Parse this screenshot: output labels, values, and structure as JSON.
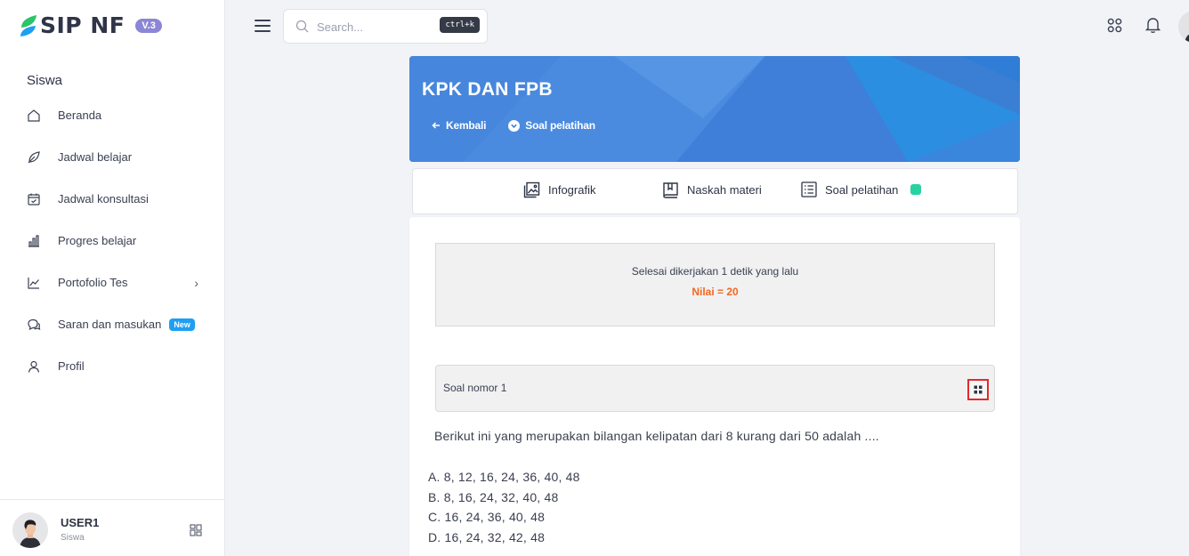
{
  "app": {
    "logo_text": "SIP NF",
    "version": "V.3"
  },
  "sidebar": {
    "section_title": "Siswa",
    "items": [
      {
        "label": "Beranda",
        "icon": "home-icon"
      },
      {
        "label": "Jadwal belajar",
        "icon": "leaf-icon"
      },
      {
        "label": "Jadwal konsultasi",
        "icon": "calendar-check-icon"
      },
      {
        "label": "Progres belajar",
        "icon": "bar-chart-icon"
      },
      {
        "label": "Portofolio Tes",
        "icon": "line-chart-icon"
      },
      {
        "label": "Saran dan masukan",
        "icon": "chat-icon",
        "badge": "New"
      },
      {
        "label": "Profil",
        "icon": "user-icon"
      }
    ]
  },
  "user": {
    "name": "USER1",
    "role": "Siswa"
  },
  "search": {
    "placeholder": "Search...",
    "shortcut": "ctrl+k"
  },
  "banner": {
    "title": "KPK DAN FPB",
    "back_label": "Kembali",
    "dropdown_label": "Soal pelatihan"
  },
  "tabs": [
    {
      "label": "Infografik",
      "icon": "image-icon"
    },
    {
      "label": "Naskah materi",
      "icon": "book-icon"
    },
    {
      "label": "Soal pelatihan",
      "icon": "list-icon"
    }
  ],
  "result": {
    "status": "Selesai dikerjakan 1 detik yang lalu",
    "score": "Nilai = 20"
  },
  "question": {
    "number_label": "Soal nomor 1",
    "text": "Berikut ini yang merupakan bilangan kelipatan dari 8 kurang dari 50 adalah ....",
    "options": [
      "A. 8, 12, 16, 24, 36, 40, 48",
      "B. 8, 16, 24, 32, 40, 48",
      "C. 16, 24, 36, 40, 48",
      "D. 16, 24, 32, 42, 48"
    ]
  },
  "colors": {
    "accent": "#3e7fd8",
    "score": "#f26722",
    "badge": "#1e9ff2",
    "active_dot": "#28d3a1",
    "highlight": "#e32a2a"
  }
}
